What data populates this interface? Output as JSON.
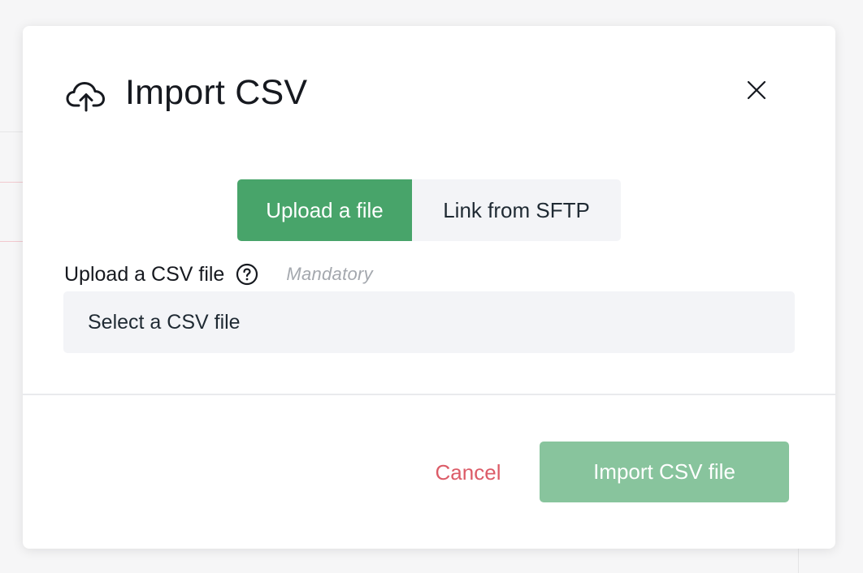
{
  "modal": {
    "title": "Import CSV",
    "icon": "cloud-upload-icon",
    "close_icon": "close-icon"
  },
  "source_toggle": {
    "options": [
      {
        "label": "Upload a file",
        "active": true
      },
      {
        "label": "Link from SFTP",
        "active": false
      }
    ]
  },
  "upload_field": {
    "label": "Upload a CSV file",
    "help_icon": "question-circle-icon",
    "mandatory": "Mandatory",
    "placeholder": "Select a CSV file"
  },
  "footer": {
    "cancel_label": "Cancel",
    "submit_label": "Import CSV file"
  },
  "colors": {
    "accent": "#48a46a",
    "accent_disabled": "#88c49d",
    "danger": "#dc5c68",
    "field_bg": "#f3f4f7"
  }
}
